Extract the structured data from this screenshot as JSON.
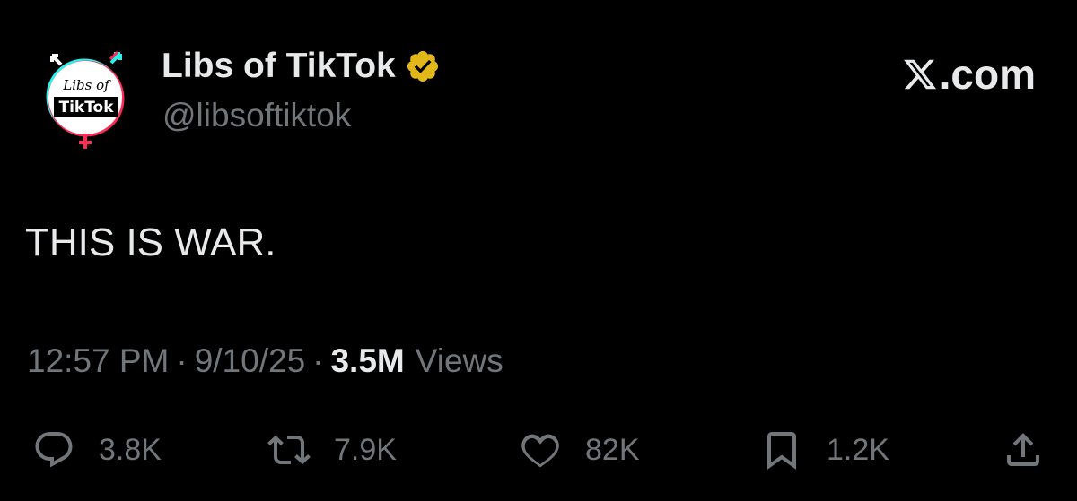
{
  "author": {
    "display_name": "Libs of TikTok",
    "handle": "@libsoftiktok",
    "verified": true,
    "verified_color": "#e2b719",
    "avatar": {
      "logo_text_top": "Libs of",
      "logo_text_bottom": "TikTok",
      "ring_colors": [
        "#25f4ee",
        "#fe2c55"
      ]
    }
  },
  "source": {
    "label": ".com",
    "logo_icon": "x-logo-icon"
  },
  "tweet": {
    "text": "THIS IS WAR."
  },
  "meta": {
    "time": "12:57 PM",
    "date": "9/10/25",
    "views_count": "3.5M",
    "views_label": "Views"
  },
  "actions": {
    "reply": {
      "icon": "reply-icon",
      "count": "3.8K"
    },
    "retweet": {
      "icon": "retweet-icon",
      "count": "7.9K"
    },
    "like": {
      "icon": "heart-icon",
      "count": "82K"
    },
    "bookmark": {
      "icon": "bookmark-icon",
      "count": "1.2K"
    },
    "share": {
      "icon": "share-icon"
    }
  },
  "colors": {
    "background": "#000000",
    "primary_text": "#e7e9ea",
    "secondary_text": "#71767b"
  }
}
